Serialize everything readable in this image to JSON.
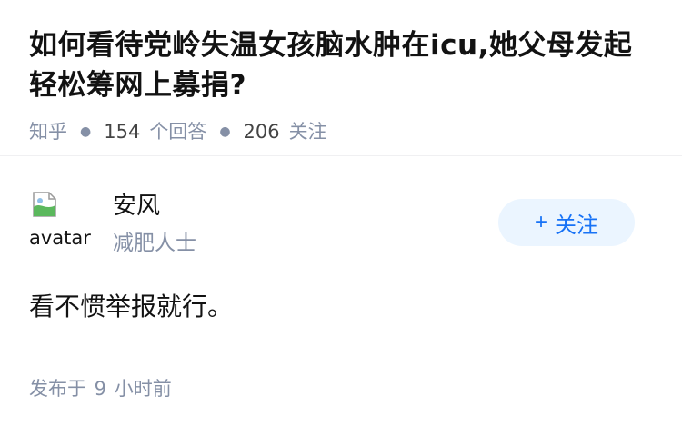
{
  "question": {
    "title": "如何看待党岭失温女孩脑水肿在icu,她父母发起轻松筹网上募捐?",
    "source": "知乎",
    "answer_count": "154",
    "answer_label": "个回答",
    "follower_count": "206",
    "follower_label": "关注"
  },
  "answer": {
    "author": {
      "name": "安风",
      "headline": "减肥人士",
      "avatar_alt": "avatar"
    },
    "follow_label": "关注",
    "follow_icon": "plus-icon",
    "content": "看不惯举报就行。",
    "published": "发布于 9 小时前"
  },
  "colors": {
    "title": "#121212",
    "meta": "#8590a6",
    "follow_bg": "#ebf5ff",
    "follow_text": "#1772f6"
  }
}
